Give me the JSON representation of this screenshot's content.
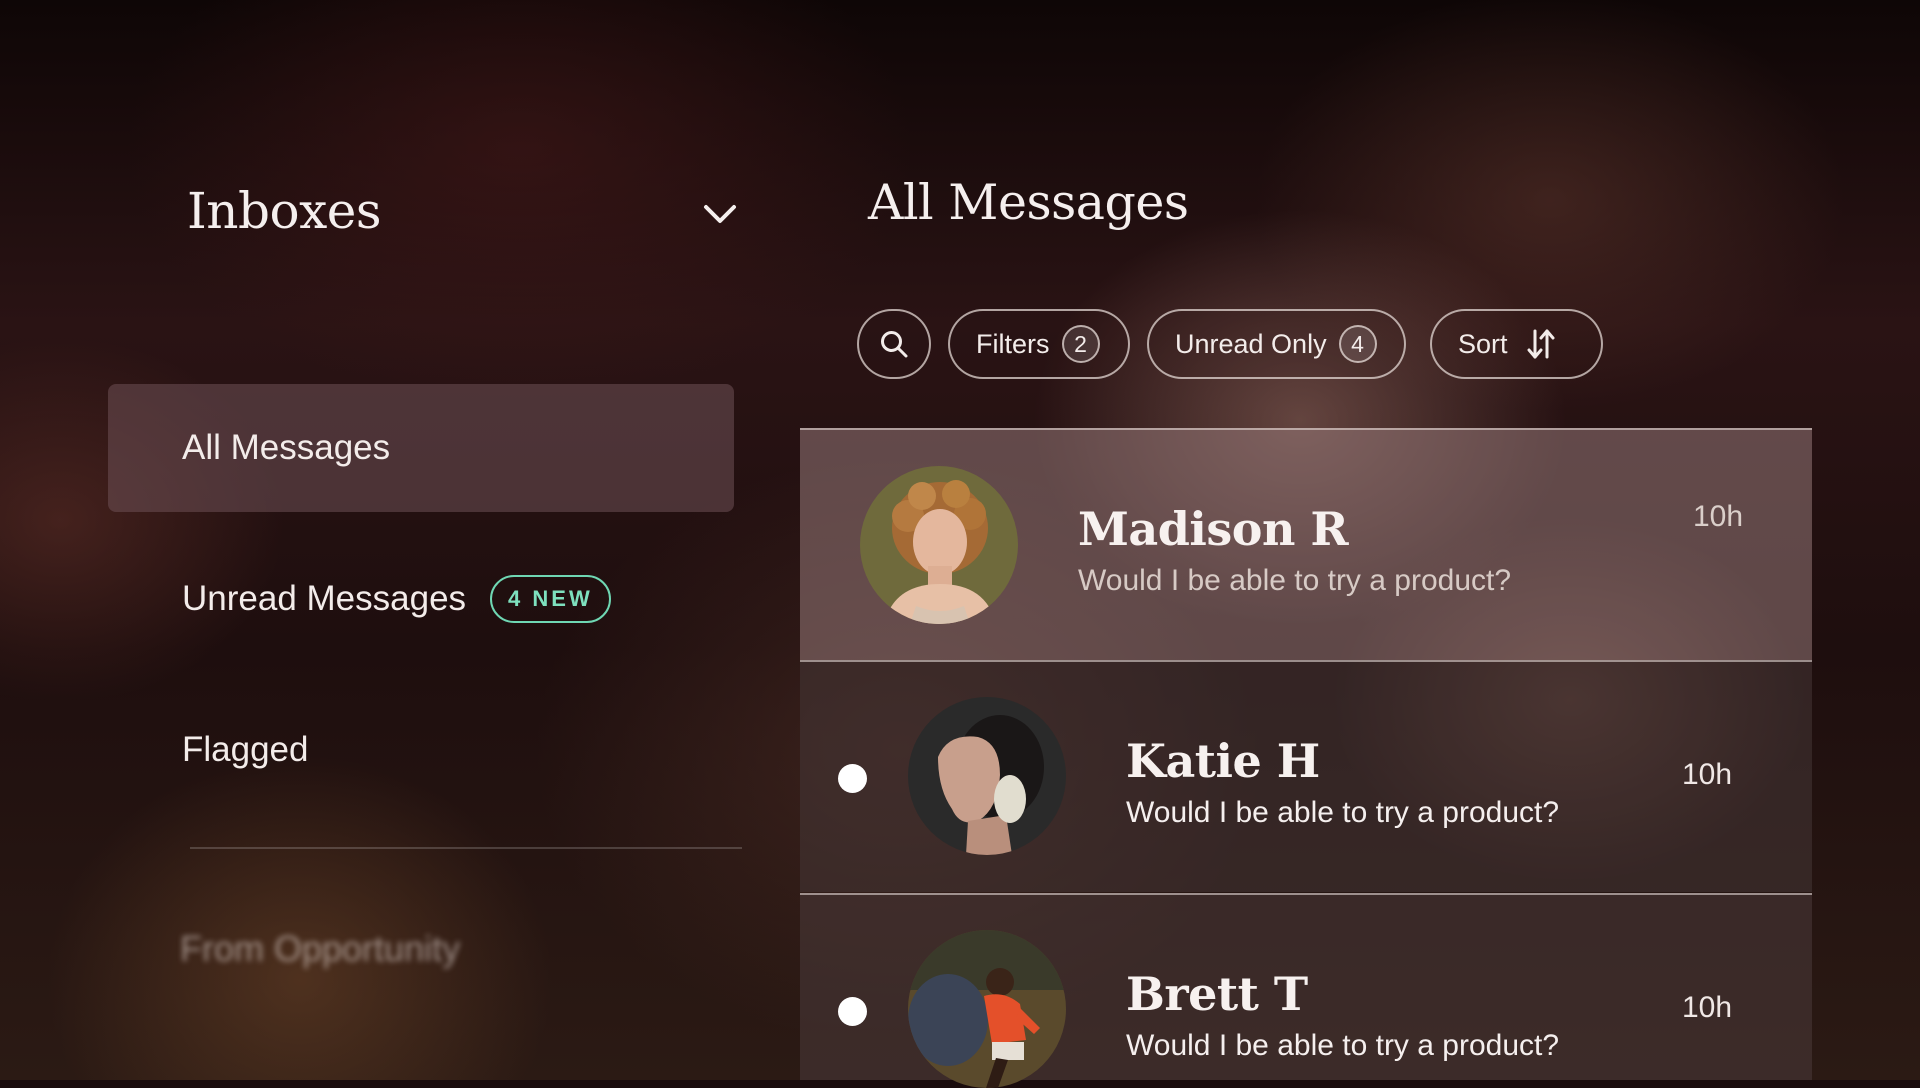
{
  "sidebar": {
    "title": "Inboxes",
    "items": [
      {
        "label": "All Messages",
        "active": true
      },
      {
        "label": "Unread Messages",
        "badge": "4 NEW"
      },
      {
        "label": "Flagged"
      }
    ],
    "section_label": "From Opportunity"
  },
  "main": {
    "title": "All Messages",
    "toolbar": {
      "search_icon": "search-icon",
      "filters_label": "Filters",
      "filters_count": "2",
      "unread_label": "Unread Only",
      "unread_count": "4",
      "sort_label": "Sort",
      "sort_icon": "sort-arrows-icon"
    },
    "messages": [
      {
        "sender": "Madison R",
        "preview": "Would I be able to try a product?",
        "time": "10h",
        "unread": false,
        "selected": true
      },
      {
        "sender": "Katie H",
        "preview": "Would I be able to try a product?",
        "time": "10h",
        "unread": true
      },
      {
        "sender": "Brett T",
        "preview": "Would I be able to try a product?",
        "time": "10h",
        "unread": true
      }
    ]
  },
  "colors": {
    "accent_badge": "#6fd7b3",
    "background": "#1a0c0d"
  }
}
